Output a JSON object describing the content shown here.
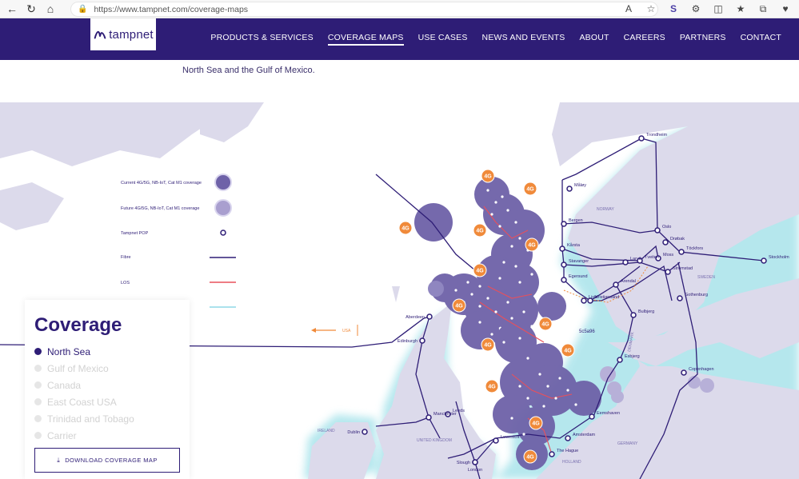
{
  "browser": {
    "url": "https://www.tampnet.com/coverage-maps"
  },
  "header": {
    "logo_text": "tampnet",
    "nav": [
      {
        "label": "PRODUCTS & SERVICES",
        "active": false
      },
      {
        "label": "COVERAGE MAPS",
        "active": true
      },
      {
        "label": "USE CASES",
        "active": false
      },
      {
        "label": "NEWS AND EVENTS",
        "active": false
      },
      {
        "label": "ABOUT",
        "active": false
      },
      {
        "label": "CAREERS",
        "active": false
      },
      {
        "label": "PARTNERS",
        "active": false
      },
      {
        "label": "CONTACT",
        "active": false
      }
    ]
  },
  "intro": {
    "text": "North Sea and the Gulf of Mexico."
  },
  "legend": {
    "current": "Current 4G/5G, NB-IoT, Cat M1 coverage",
    "future": "Future 4G/5G, NB-IoT, Cat M1 coverage",
    "pop": "Tampnet POP",
    "fibre": "Fibre",
    "los": "LOS"
  },
  "colors": {
    "brand": "#2e1d76",
    "coverage": "#6e62a8",
    "land": "#dcdaeb",
    "glow": "#bfe9ef",
    "orange": "#f08a3a",
    "los": "#e8505b",
    "future": "#a99fcf"
  },
  "map": {
    "usa_label": "USA",
    "sea_label": "5c5a96",
    "countries": [
      "NORWAY",
      "SWEDEN",
      "DENMARK",
      "UNITED KINGDOM",
      "IRELAND",
      "GERMANY",
      "HOLLAND"
    ],
    "cities": [
      "Trondheim",
      "Måløy",
      "Bergen",
      "Oslo",
      "Drøbak",
      "Töckfors",
      "Kårsta",
      "Tveiten",
      "Moss",
      "Stockholm",
      "Larvik",
      "Strömstad",
      "Stavanger",
      "Arendal",
      "Egersund",
      "Kristiansand",
      "Lista",
      "Gothenburg",
      "Aberdeen",
      "Bulbjerg",
      "Edinburgh",
      "Esbjerg",
      "Copenhagen",
      "Leeds",
      "Eemshaven",
      "Dublin",
      "Manchester",
      "Amsterdam",
      "Lowestoft",
      "Slough",
      "The Hague",
      "London"
    ]
  },
  "coverage": {
    "title": "Coverage",
    "regions": [
      {
        "label": "North Sea",
        "active": true
      },
      {
        "label": "Gulf of Mexico",
        "active": false
      },
      {
        "label": "Canada",
        "active": false
      },
      {
        "label": "East Coast USA",
        "active": false
      },
      {
        "label": "Trinidad and Tobago",
        "active": false
      },
      {
        "label": "Carrier",
        "active": false
      }
    ],
    "download_label": "DOWNLOAD COVERAGE MAP"
  },
  "badge_label": "4G"
}
